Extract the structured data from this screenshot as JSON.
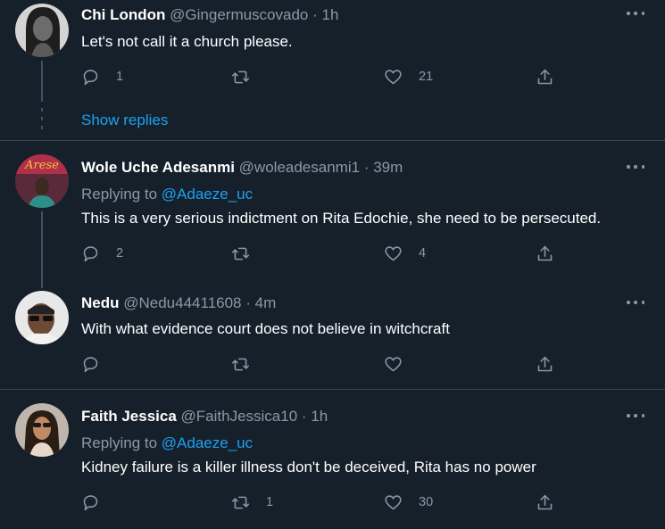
{
  "colors": {
    "background": "#15202b",
    "divider": "#38444d",
    "link": "#1da1f2",
    "secondary_text": "#8899a6",
    "thread_line": "#3d5466"
  },
  "tweets": [
    {
      "name": "Chi London",
      "handle": "@Gingermuscovado",
      "separator": "·",
      "time": "1h",
      "text": "Let's not call it a church please.",
      "replies": "1",
      "retweets": "",
      "likes": "21",
      "show_replies": "Show replies",
      "avatar_icon": "user-avatar"
    },
    {
      "name": "Wole Uche Adesanmi",
      "handle": "@woleadesanmi1",
      "separator": "·",
      "time": "39m",
      "replying_label": "Replying to",
      "replying_to": "@Adaeze_uc",
      "text": "This is a very serious indictment on Rita Edochie, she need to be persecuted.",
      "replies": "2",
      "retweets": "",
      "likes": "4",
      "avatar_icon": "user-avatar"
    },
    {
      "name": "Nedu",
      "handle": "@Nedu44411608",
      "separator": "·",
      "time": "4m",
      "text": "With what evidence court does not believe in witchcraft",
      "replies": "",
      "retweets": "",
      "likes": "",
      "avatar_icon": "user-avatar"
    },
    {
      "name": "Faith Jessica",
      "handle": "@FaithJessica10",
      "separator": "·",
      "time": "1h",
      "replying_label": "Replying to",
      "replying_to": "@Adaeze_uc",
      "text": "Kidney failure is a killer illness don't be deceived, Rita has no power",
      "replies": "",
      "retweets": "1",
      "likes": "30",
      "avatar_icon": "user-avatar"
    }
  ],
  "icons": {
    "reply": "reply-icon",
    "retweet": "retweet-icon",
    "like": "heart-icon",
    "share": "share-icon",
    "more": "more-icon"
  }
}
